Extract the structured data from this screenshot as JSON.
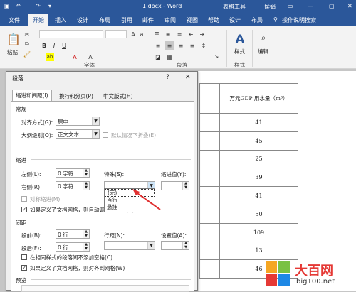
{
  "titlebar": {
    "doc_title": "1.docx - Word",
    "context_tab": "表格工具",
    "user": "侯娟",
    "colors": {
      "bar": "#2b579a",
      "accent_red": "#e03030"
    }
  },
  "ribbon_tabs": [
    "文件",
    "开始",
    "插入",
    "设计",
    "布局",
    "引用",
    "邮件",
    "审阅",
    "视图",
    "帮助",
    "设计",
    "布局"
  ],
  "tell_me": "操作说明搜索",
  "ribbon": {
    "paste_label": "粘贴",
    "font_group_label": "字体",
    "paragraph_group_label": "段落",
    "styles_group_label": "样式",
    "styles_label": "样式",
    "editing_label": "编辑",
    "bold": "B",
    "italic": "I",
    "underline": "U",
    "font_color": "A",
    "font_label": "A"
  },
  "dialog": {
    "title": "段落",
    "help": "?",
    "close": "✕",
    "tabs": [
      "缩进和间距(I)",
      "换行和分页(P)",
      "中文版式(H)"
    ],
    "general": {
      "section": "常规",
      "alignment_label": "对齐方式(G):",
      "alignment_value": "居中",
      "outline_label": "大纲级别(O):",
      "outline_value": "正文文本",
      "collapsed_label": "默认情况下折叠(E)"
    },
    "indent": {
      "section": "缩进",
      "left_label": "左侧(L):",
      "left_value": "0 字符",
      "right_label": "右侧(R):",
      "right_value": "0 字符",
      "special_label": "特殊(S):",
      "special_value": "",
      "indent_value_label": "缩进值(Y):",
      "mirror_label": "对称缩进(M)",
      "grid_label": "如果定义了文档网格，则自动调整右缩进(D)",
      "special_options": [
        "(无)",
        "首行",
        "悬挂"
      ]
    },
    "spacing": {
      "section": "间距",
      "before_label": "段前(B):",
      "before_value": "0 行",
      "after_label": "段后(F):",
      "after_value": "0 行",
      "line_label": "行距(N):",
      "setting_label": "设置值(A):",
      "no_space_label": "在相同样式的段落间不添加空格(C)",
      "snap_label": "如果定义了文档网格，则对齐到网格(W)"
    },
    "preview_section": "预览"
  },
  "document_table": {
    "header": "万元GDP 用水量（m³）",
    "values": [
      "41",
      "45",
      "25",
      "39",
      "41",
      "50",
      "109",
      "13",
      "46",
      ""
    ]
  },
  "watermark": {
    "site_name": "大百网",
    "site_url": "big100.net"
  }
}
